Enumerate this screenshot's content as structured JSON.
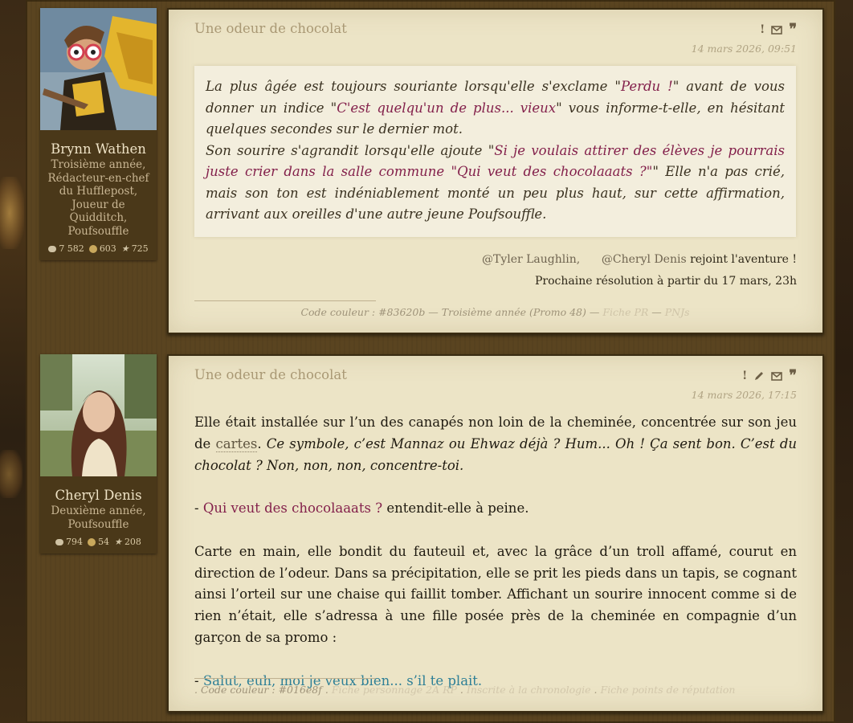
{
  "posts": [
    {
      "author": {
        "name": "Brynn Wathen",
        "rank": "Troisième année, Rédacteur-en-chef du Hufflepost, Joueur de Quidditch, Poufsouffle",
        "messages": "7 582",
        "coins": "603",
        "stars": "725"
      },
      "title": "Une odeur de chocolat",
      "date": "14 mars 2026, 09:51",
      "quote": {
        "s1": "La plus âgée est toujours souriante lorsqu'elle s'exclame \"",
        "s2": "Perdu !",
        "s3": "\" avant de vous donner un indice \"",
        "s4": "C'est quelqu'un de plus... vieux",
        "s5": "\" vous informe-t-elle, en hésitant quelques secondes sur le dernier mot.",
        "s6": "Son sourire s'agrandit lorsqu'elle ajoute \"",
        "s7": "Si je voulais attirer des élèves je pourrais juste crier dans la salle commune \"Qui veut des chocolaaats ?\"",
        "s8": "\" Elle n'a pas crié, mais son ton est indéniablement monté un peu plus haut, sur cette affirmation, arrivant aux oreilles d'une autre jeune Poufsouffle."
      },
      "mention": {
        "who1": "@Tyler Laughlin,",
        "who2": "@Cheryl Denis",
        "tail": "rejoint l'aventure !",
        "next": "Prochaine résolution à partir du 17 mars, 23h"
      },
      "signature": {
        "text": "Code couleur : #83620b — Troisième année (Promo 48) —",
        "link1": "Fiche PR",
        "sep": "—",
        "link2": "PNJs"
      }
    },
    {
      "author": {
        "name": "Cheryl Denis",
        "rank": "Deuxième année, Poufsouffle",
        "messages": "794",
        "coins": "54",
        "stars": "208"
      },
      "title": "Une odeur de chocolat",
      "date": "14 mars 2026, 17:15",
      "p1a": "Elle était installée sur l’un des canapés non loin de la cheminée, concentrée sur son jeu de",
      "p1link": "cartes",
      "p1b": ". ",
      "p1c": "Ce symbole, c’est Mannaz ou Ehwaz déjà ? Hum... Oh ! Ça sent bon. C’est du chocolat ? Non, non, non, concentre-toi.",
      "p2dash": "- ",
      "p2q": "Qui veut des chocolaaats ?",
      "p2b": " entendit-elle à peine.",
      "p3": "Carte en main, elle bondit du fauteuil et, avec la grâce d’un troll affamé, courut en direction de l’odeur. Dans sa précipitation, elle se prit les pieds dans un tapis, se cognant ainsi l’orteil sur une chaise qui faillit tomber. Affichant un sourire innocent comme si de rien n’était, elle s’adressa à une fille posée près de la cheminée en compagnie d’un garçon de sa promo :",
      "p4dash": "- ",
      "p4q": "Salut, euh, moi je veux bien... s’il te plait.",
      "signature": {
        "text": ". Code couleur : #016e8f .",
        "link1": "Fiche personnage 2A RP",
        "sep1": ".",
        "link2": "Inscrite à la chronologie",
        "sep2": ".",
        "link3": "Fiche points de réputation"
      }
    }
  ],
  "colors": {
    "accent_magenta": "#83204b",
    "accent_teal": "#2e7f96",
    "panel": "#ece4c6",
    "frame": "#5a4420"
  }
}
